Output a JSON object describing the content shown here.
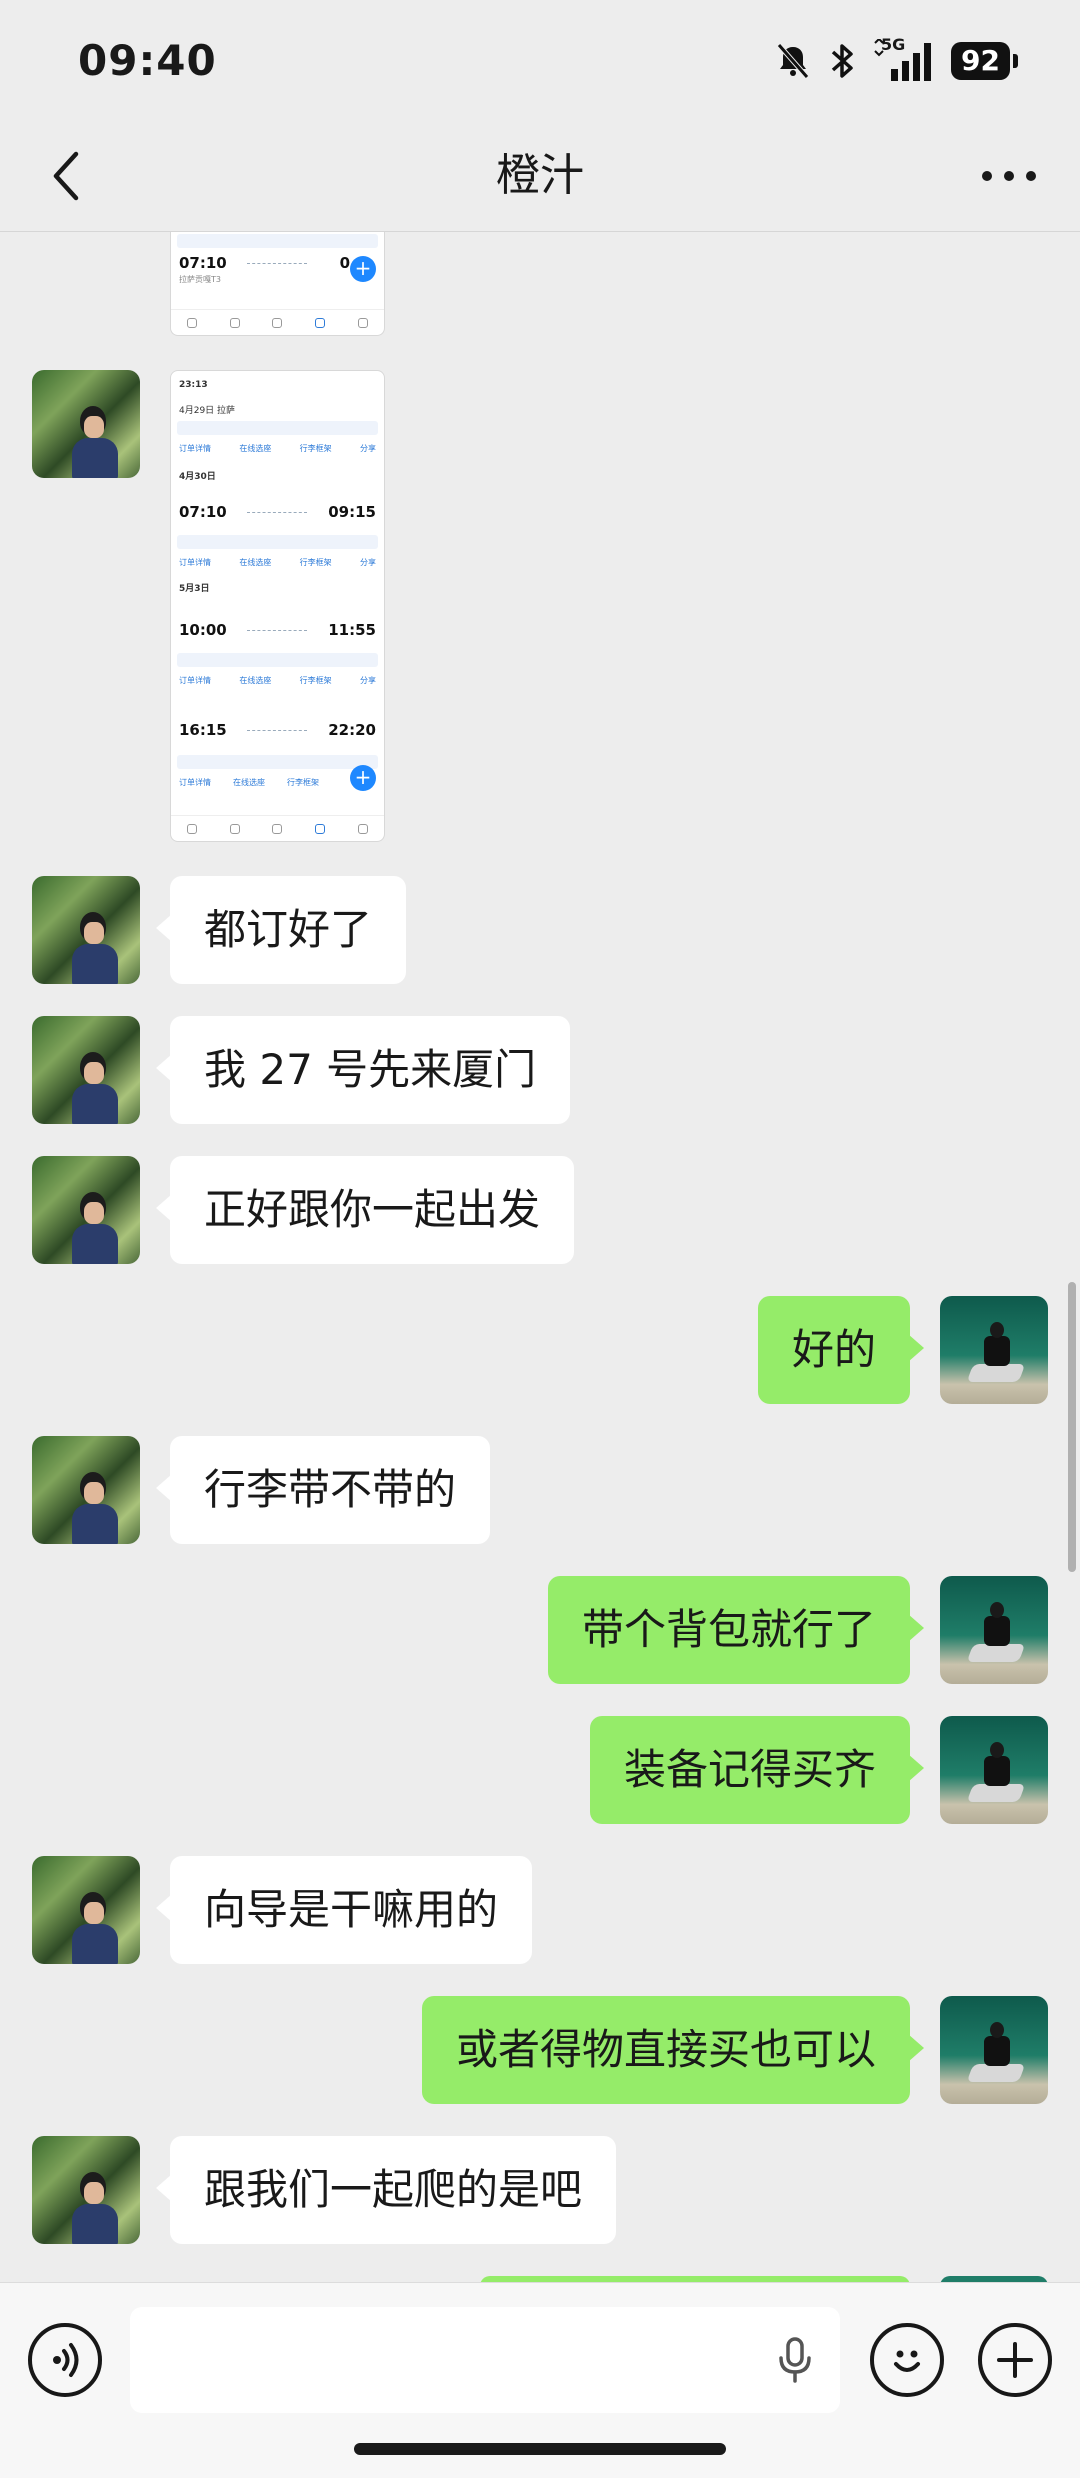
{
  "status_bar": {
    "time": "09:40",
    "network": "5G",
    "battery": "92"
  },
  "header": {
    "title": "橙汁",
    "back_icon": "chevron-left-icon",
    "more_icon": "more-dots-icon"
  },
  "screenshots": [
    {
      "flights": [
        {
          "time": "07:10",
          "arr": "0",
          "label": "拉萨贡嘎T3"
        }
      ]
    },
    {
      "top_time": "23:13",
      "date_1": "4月29日 拉萨",
      "date_2": "4月30日",
      "date_3": "5月3日",
      "flights": [
        {
          "dep": "07:10",
          "arr": "09:15"
        },
        {
          "dep": "10:00",
          "arr": "11:55"
        },
        {
          "dep": "16:15",
          "arr": "22:20"
        }
      ],
      "actions": [
        "订单详情",
        "在线选座",
        "行李框架",
        "分享"
      ]
    }
  ],
  "messages": [
    {
      "side": "left",
      "text": "都订好了"
    },
    {
      "side": "left",
      "text": "我 27 号先来厦门"
    },
    {
      "side": "left",
      "text": "正好跟你一起出发"
    },
    {
      "side": "right",
      "text": "好的"
    },
    {
      "side": "left",
      "text": "行李带不带的"
    },
    {
      "side": "right",
      "text": "带个背包就行了"
    },
    {
      "side": "right",
      "text": "装备记得买齐"
    },
    {
      "side": "left",
      "text": "向导是干嘛用的"
    },
    {
      "side": "right",
      "text": "或者得物直接买也可以"
    },
    {
      "side": "left",
      "text": "跟我们一起爬的是吧"
    }
  ],
  "input_bar": {
    "voice_icon": "voice-mode-icon",
    "mic_icon": "microphone-icon",
    "emoji_icon": "emoji-icon",
    "plus_icon": "plus-icon",
    "value": ""
  },
  "colors": {
    "background": "#ededed",
    "outgoing": "#95ec69",
    "incoming": "#ffffff"
  }
}
